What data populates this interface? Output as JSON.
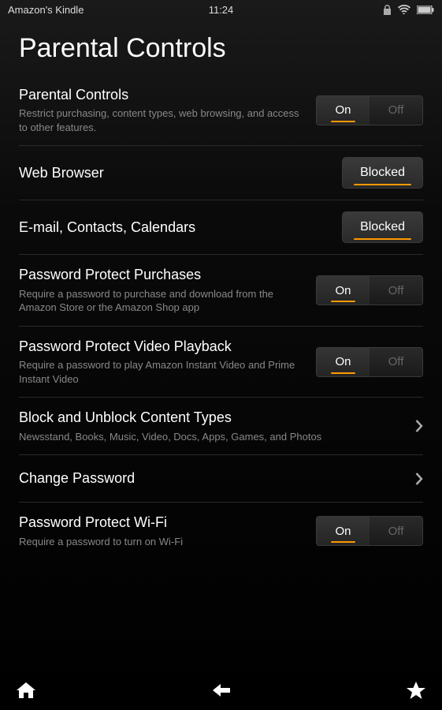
{
  "status": {
    "appName": "Amazon's Kindle",
    "time": "11:24"
  },
  "page": {
    "title": "Parental Controls"
  },
  "settings": {
    "parentalControls": {
      "title": "Parental Controls",
      "subtitle": "Restrict purchasing, content types, web browsing, and access to other features.",
      "on": "On",
      "off": "Off",
      "state": "on"
    },
    "webBrowser": {
      "title": "Web Browser",
      "button": "Blocked"
    },
    "emailContacts": {
      "title": "E-mail, Contacts, Calendars",
      "button": "Blocked"
    },
    "passwordPurchases": {
      "title": "Password Protect Purchases",
      "subtitle": "Require a password to purchase and download from the Amazon Store or the Amazon Shop app",
      "on": "On",
      "off": "Off",
      "state": "on"
    },
    "passwordVideo": {
      "title": "Password Protect Video Playback",
      "subtitle": "Require a password to play Amazon Instant Video and Prime Instant Video",
      "on": "On",
      "off": "Off",
      "state": "on"
    },
    "blockContent": {
      "title": "Block and Unblock Content Types",
      "subtitle": "Newsstand, Books, Music, Video, Docs, Apps, Games, and Photos"
    },
    "changePassword": {
      "title": "Change Password"
    },
    "passwordWifi": {
      "title": "Password Protect Wi-Fi",
      "subtitle": "Require a password to turn on Wi-Fi",
      "on": "On",
      "off": "Off",
      "state": "on"
    }
  }
}
